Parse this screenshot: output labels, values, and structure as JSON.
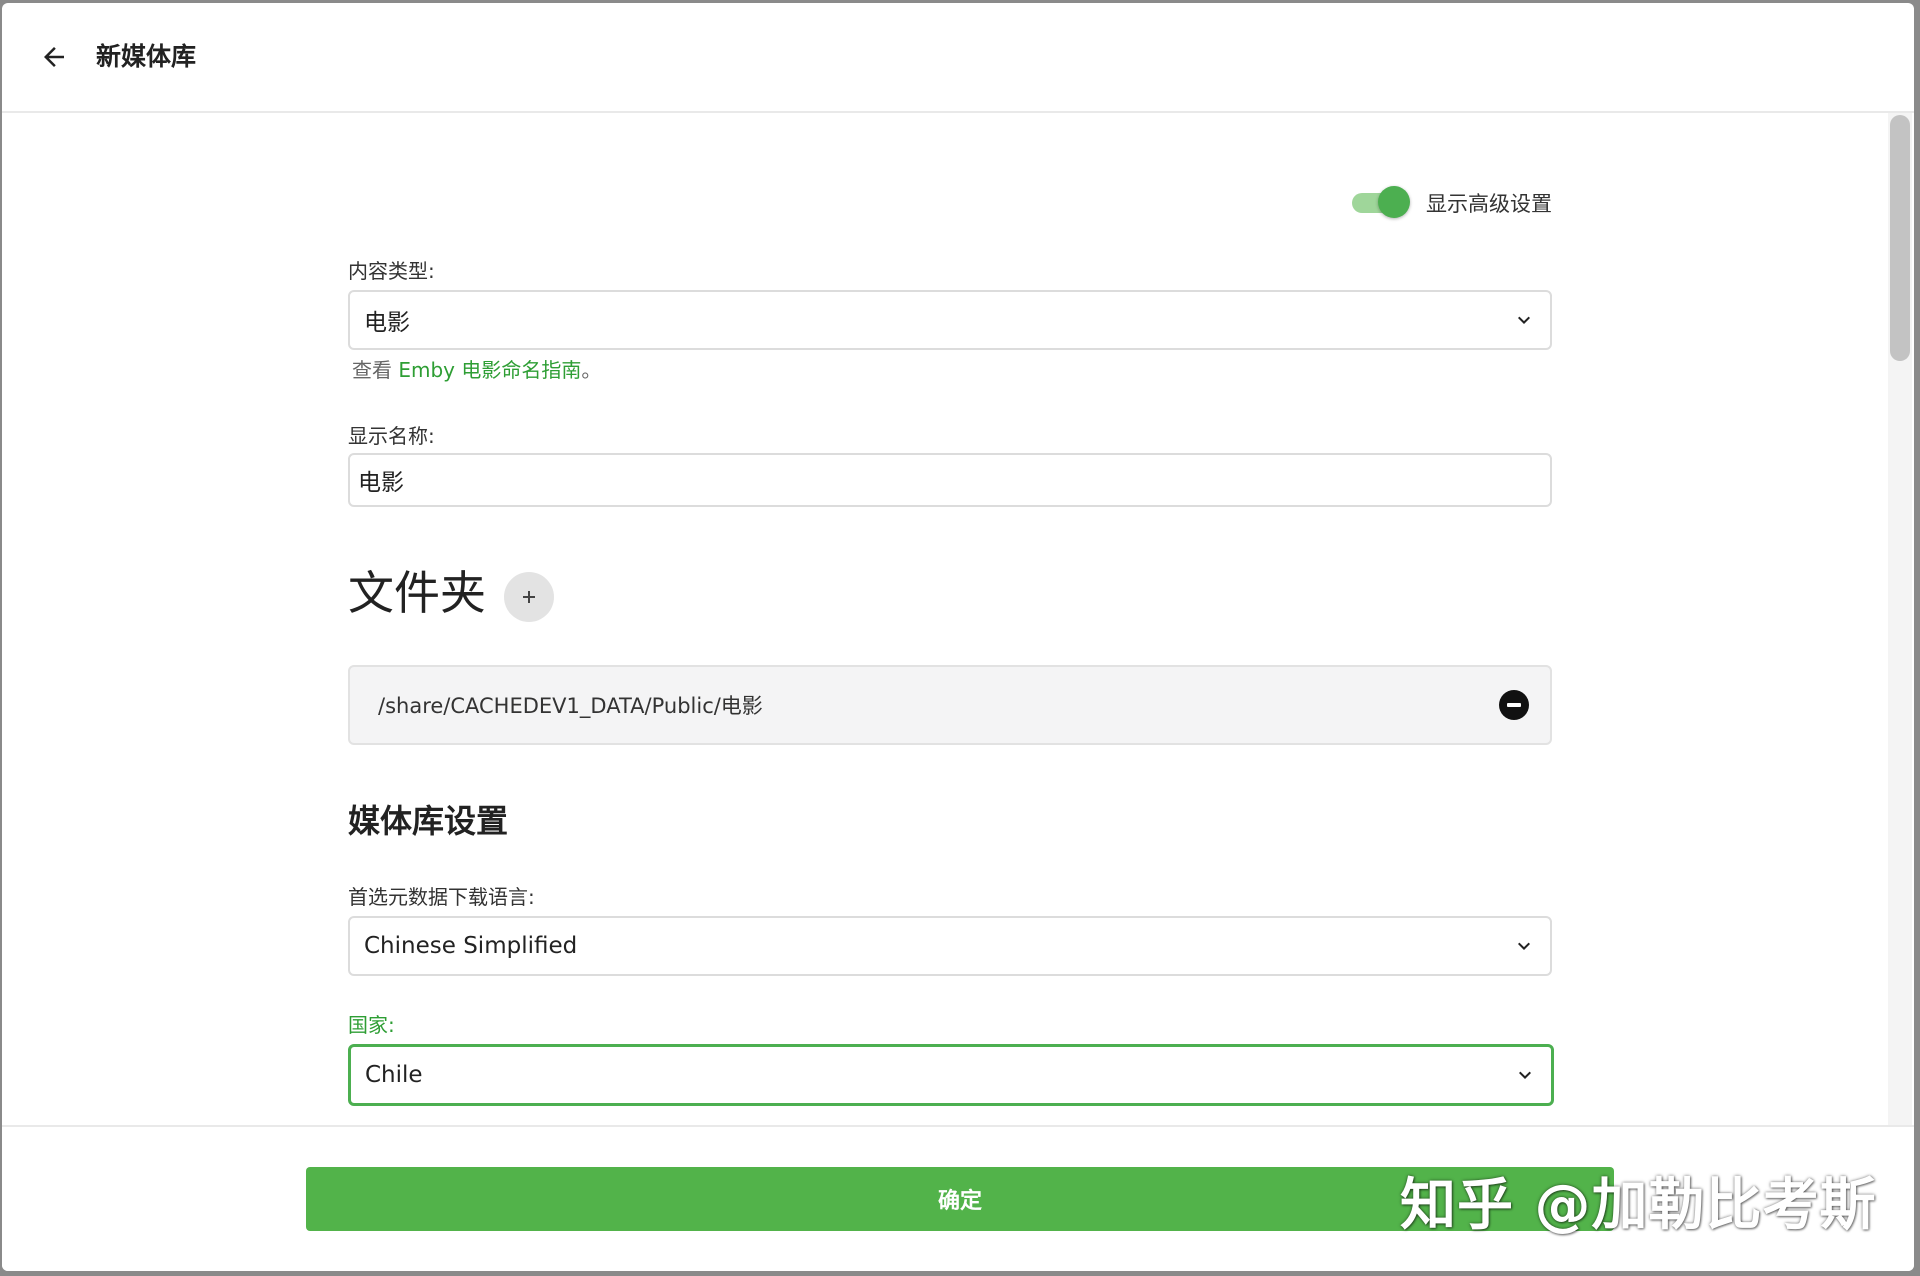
{
  "header": {
    "title": "新媒体库",
    "back_icon": "arrow-left-icon"
  },
  "advanced_toggle": {
    "label": "显示高级设置",
    "on": true,
    "color": "#4caf50"
  },
  "content_type": {
    "label": "内容类型:",
    "value": "电影",
    "hint_prefix": "查看 ",
    "hint_link": "Emby 电影命名指南",
    "hint_suffix": "。"
  },
  "display_name": {
    "label": "显示名称:",
    "value": "电影"
  },
  "folders": {
    "title": "文件夹",
    "add_icon": "plus-icon",
    "items": [
      {
        "path": "/share/CACHEDEV1_DATA/Public/电影",
        "remove_icon": "minus-circle-icon"
      }
    ]
  },
  "library_settings": {
    "title": "媒体库设置",
    "metadata_language": {
      "label": "首选元数据下载语言:",
      "value": "Chinese Simplified"
    },
    "country": {
      "label": "国家:",
      "value": "Chile"
    }
  },
  "footer": {
    "confirm_label": "确定"
  },
  "watermark": {
    "text": "知乎 @加勒比考斯"
  },
  "colors": {
    "accent": "#4caf50",
    "button": "#52b34a",
    "link": "#2e9e34"
  }
}
